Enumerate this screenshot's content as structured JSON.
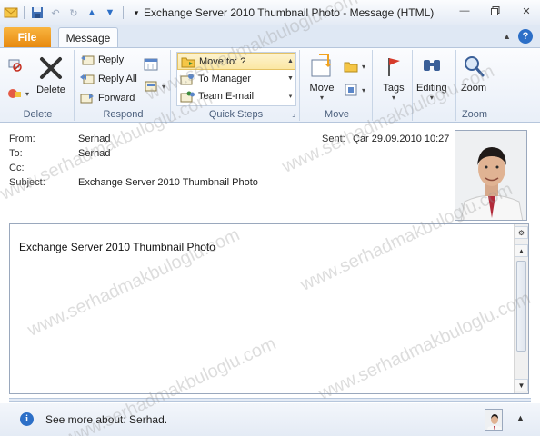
{
  "window": {
    "title": "Exchange Server 2010 Thumbnail Photo  -  Message (HTML)"
  },
  "tabs": {
    "file": "File",
    "message": "Message"
  },
  "ribbon": {
    "delete_group": {
      "label": "Delete",
      "delete": "Delete"
    },
    "respond_group": {
      "label": "Respond",
      "reply": "Reply",
      "reply_all": "Reply All",
      "forward": "Forward"
    },
    "quick_steps_group": {
      "label": "Quick Steps",
      "items": [
        "Move to: ?",
        "To Manager",
        "Team E-mail"
      ]
    },
    "move_group": {
      "label": "Move",
      "move": "Move"
    },
    "tags": "Tags",
    "editing": "Editing",
    "zoom_group": {
      "label": "Zoom",
      "zoom": "Zoom"
    }
  },
  "header": {
    "from_label": "From:",
    "from_value": "Serhad",
    "to_label": "To:",
    "to_value": "Serhad",
    "cc_label": "Cc:",
    "subject_label": "Subject:",
    "subject_value": "Exchange Server 2010 Thumbnail Photo",
    "sent_label": "Sent:",
    "sent_value": "Çar 29.09.2010 10:27"
  },
  "body": {
    "text": "Exchange Server 2010 Thumbnail Photo"
  },
  "people_pane": {
    "text": "See more about: Serhad."
  },
  "watermark": "www.serhadmakbuloglu.com",
  "colors": {
    "file_tab": "#e7890f",
    "accent_blue": "#2c6fc7",
    "ribbon_bg": "#e9eff8"
  }
}
